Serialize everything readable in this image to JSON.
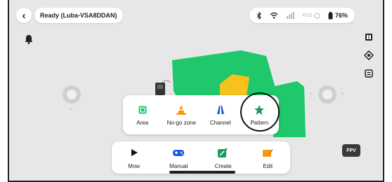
{
  "status": {
    "text": "Ready  (Luba-VSA8DDAN)"
  },
  "system": {
    "battery_percent": "76%",
    "pos_label": "POS"
  },
  "mode_popup": {
    "items": [
      {
        "label": "Area",
        "icon": "area-icon"
      },
      {
        "label": "No-go zone",
        "icon": "cone-icon"
      },
      {
        "label": "Channel",
        "icon": "channel-icon"
      },
      {
        "label": "Pattern",
        "icon": "star-icon"
      }
    ]
  },
  "bottom_bar": {
    "items": [
      {
        "label": "Mow",
        "icon": "play-icon"
      },
      {
        "label": "Manual",
        "icon": "gamepad-icon"
      },
      {
        "label": "Create",
        "icon": "create-icon"
      },
      {
        "label": "Edit",
        "icon": "pencil-icon"
      }
    ]
  },
  "fpv": {
    "label": "FPV"
  },
  "colors": {
    "accent_green": "#1fc86a",
    "warning_yellow": "#f7c21c",
    "background": "#e7e7e7"
  }
}
